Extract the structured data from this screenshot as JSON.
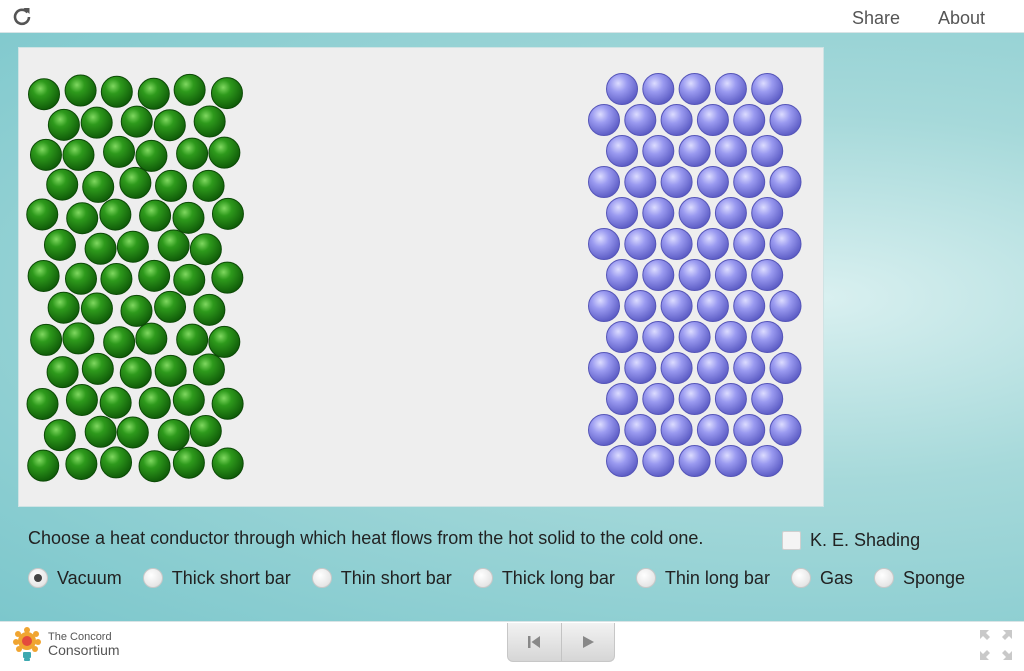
{
  "topbar": {
    "share_label": "Share",
    "about_label": "About",
    "reload_icon": "reload-icon"
  },
  "simulation": {
    "hot_solid_color": "#2e8b1e",
    "cold_solid_color": "#8f8fe6",
    "background_color": "#eeeeee"
  },
  "controls": {
    "prompt": "Choose a heat conductor through which heat flows from the hot solid to the cold one.",
    "ke_shading_label": "K. E. Shading",
    "ke_shading_checked": false,
    "options": [
      {
        "label": "Vacuum",
        "checked": true
      },
      {
        "label": "Thick short bar",
        "checked": false
      },
      {
        "label": "Thin short bar",
        "checked": false
      },
      {
        "label": "Thick long bar",
        "checked": false
      },
      {
        "label": "Thin long bar",
        "checked": false
      },
      {
        "label": "Gas",
        "checked": false
      },
      {
        "label": "Sponge",
        "checked": false
      }
    ]
  },
  "footer": {
    "logo_line1": "The Concord",
    "logo_line2": "Consortium",
    "logo_icon": "concord-logo-icon",
    "reset_icon": "step-back-icon",
    "play_icon": "play-icon",
    "fullscreen_icon": "fullscreen-icon"
  }
}
